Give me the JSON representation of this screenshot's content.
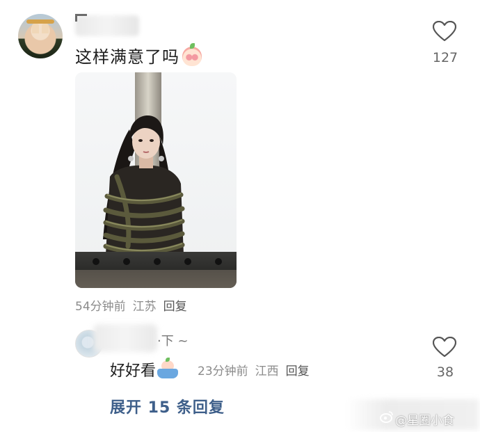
{
  "comment": {
    "username_partial": "Ⅱ",
    "text": "这样满意了吗",
    "emoji": "peach-face-emoji",
    "like_count": "127",
    "time": "54分钟前",
    "location": "江苏",
    "reply_label": "回复"
  },
  "reply": {
    "username_tail": "·下 ~",
    "text": "好好看",
    "emoji": "bath-emoji",
    "time": "23分钟前",
    "location": "江西",
    "reply_label": "回复",
    "like_count": "38"
  },
  "expand_label": "展开 15 条回复",
  "watermark": "@星圈小食",
  "colors": {
    "link_blue": "#3e5f8a",
    "meta_gray": "#8b8b8b",
    "text_dark": "#1d1d1d"
  }
}
